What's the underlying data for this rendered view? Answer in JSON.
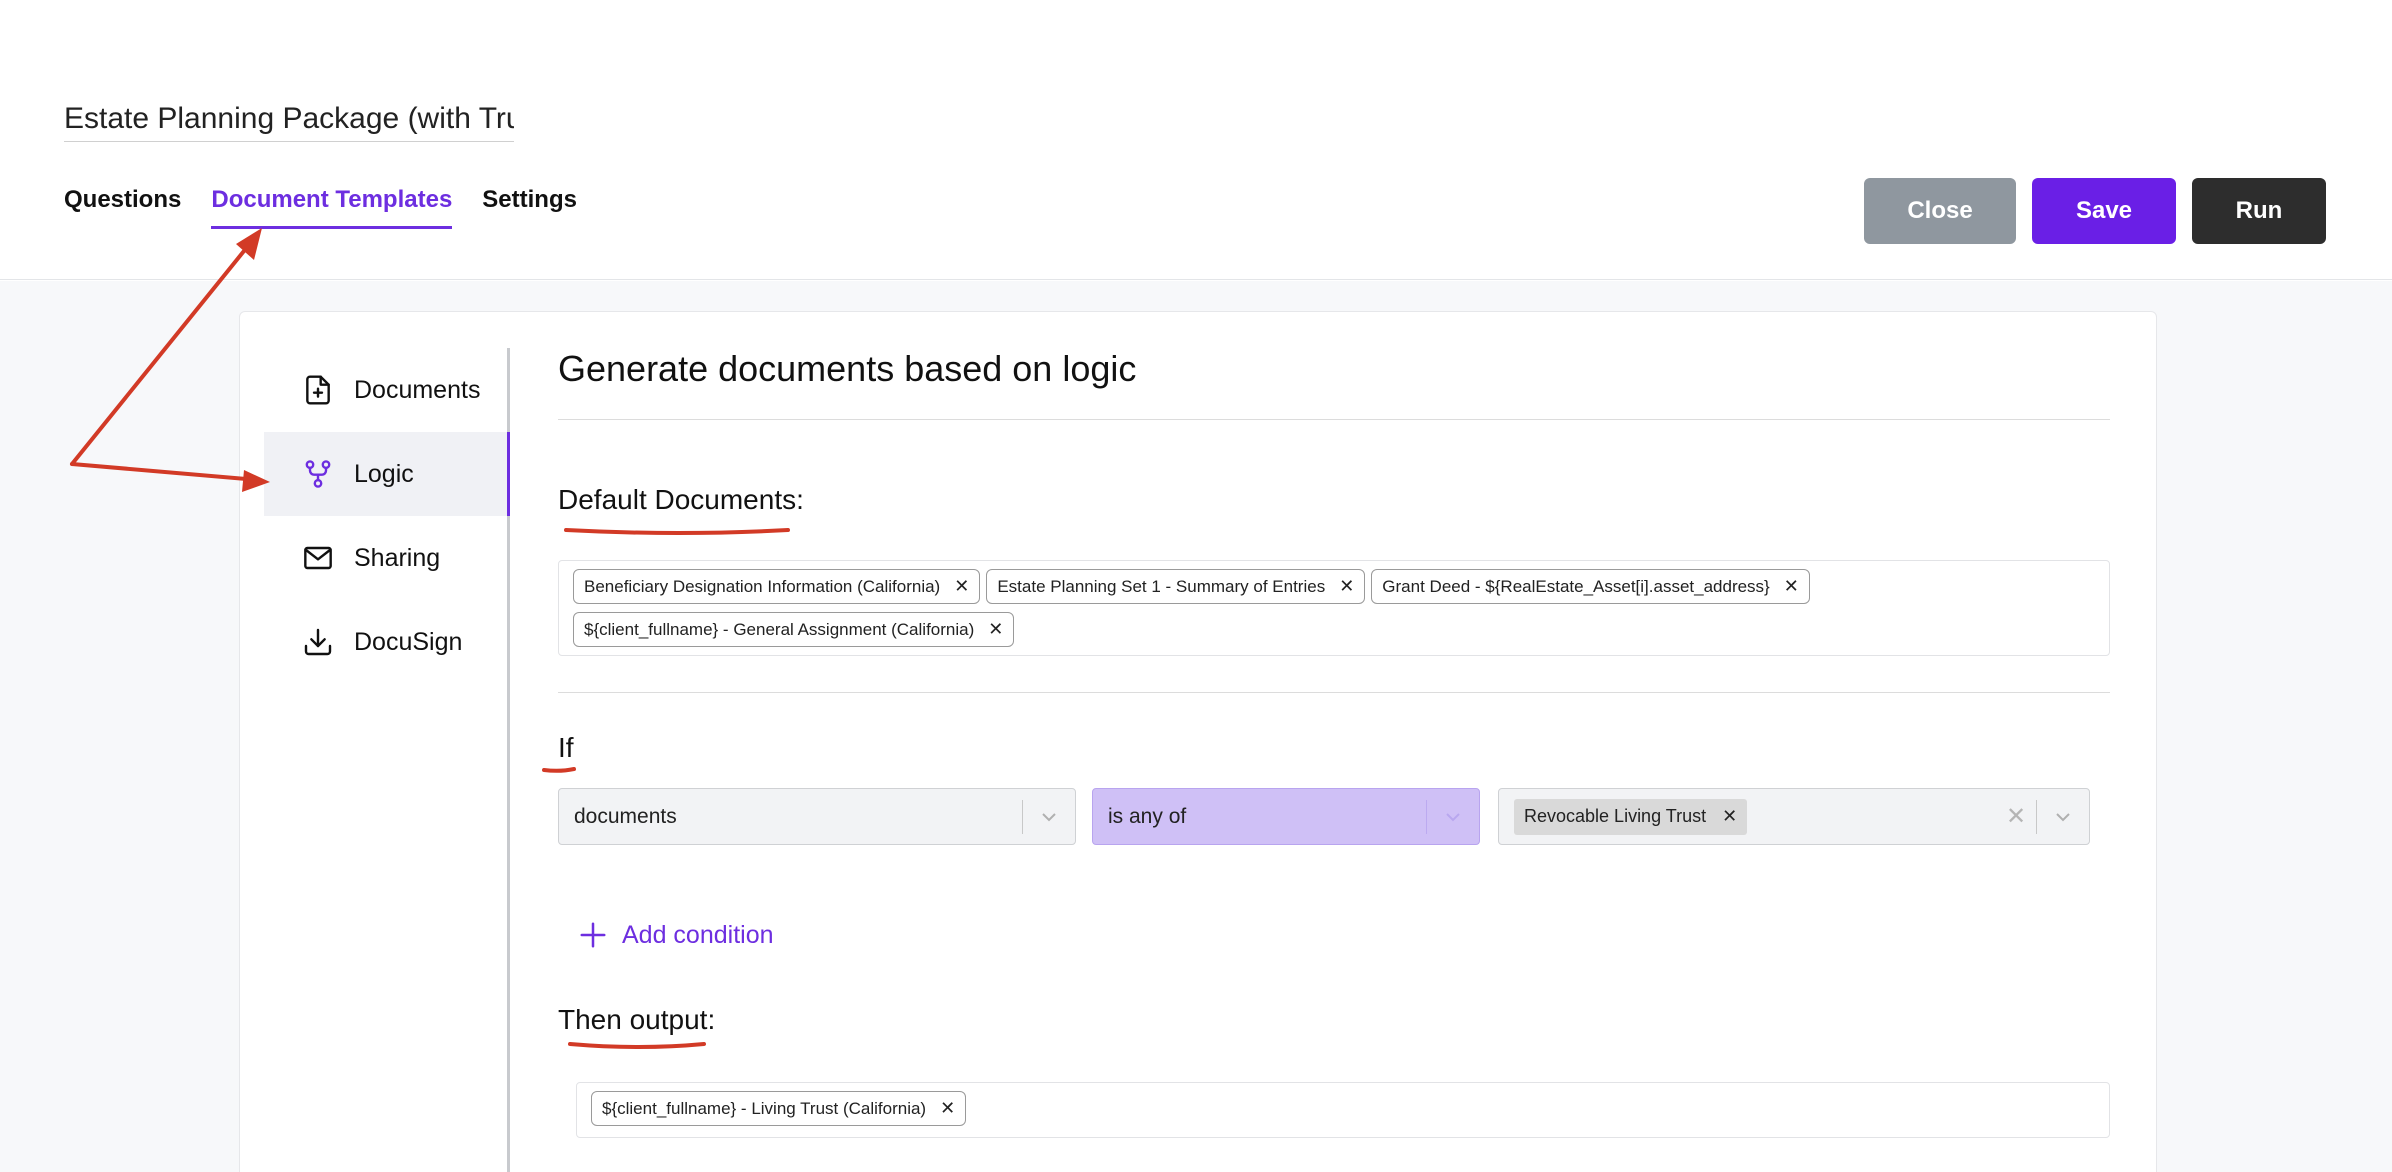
{
  "header": {
    "title_value": "Estate Planning Package (with Trust)",
    "tabs": [
      "Questions",
      "Document Templates",
      "Settings"
    ],
    "active_tab": "Document Templates",
    "buttons": {
      "close": "Close",
      "save": "Save",
      "run": "Run"
    }
  },
  "sidebar": {
    "items": [
      {
        "label": "Documents",
        "icon": "file-plus-icon"
      },
      {
        "label": "Logic",
        "icon": "branch-icon",
        "active": true
      },
      {
        "label": "Sharing",
        "icon": "envelope-icon"
      },
      {
        "label": "DocuSign",
        "icon": "download-icon"
      }
    ]
  },
  "main": {
    "section_title": "Generate documents based on logic",
    "default_label": "Default Documents:",
    "default_docs": [
      "Beneficiary Designation Information (California)",
      "Estate Planning Set 1 - Summary of Entries",
      "Grant Deed - ${RealEstate_Asset[i].asset_address}",
      "${client_fullname} - General Assignment (California)"
    ],
    "if_label": "If",
    "condition": {
      "field": "documents",
      "operator": "is any of",
      "value_tag": "Revocable Living Trust"
    },
    "add_condition": "Add condition",
    "then_label": "Then output:",
    "output_docs": [
      "${client_fullname} - Living Trust (California)"
    ]
  },
  "colors": {
    "accent": "#6d2ee0",
    "save_button": "#6a1fe6",
    "close_button": "#8f979f",
    "run_button": "#2d2d2d",
    "annotation_red": "#d23a26"
  }
}
